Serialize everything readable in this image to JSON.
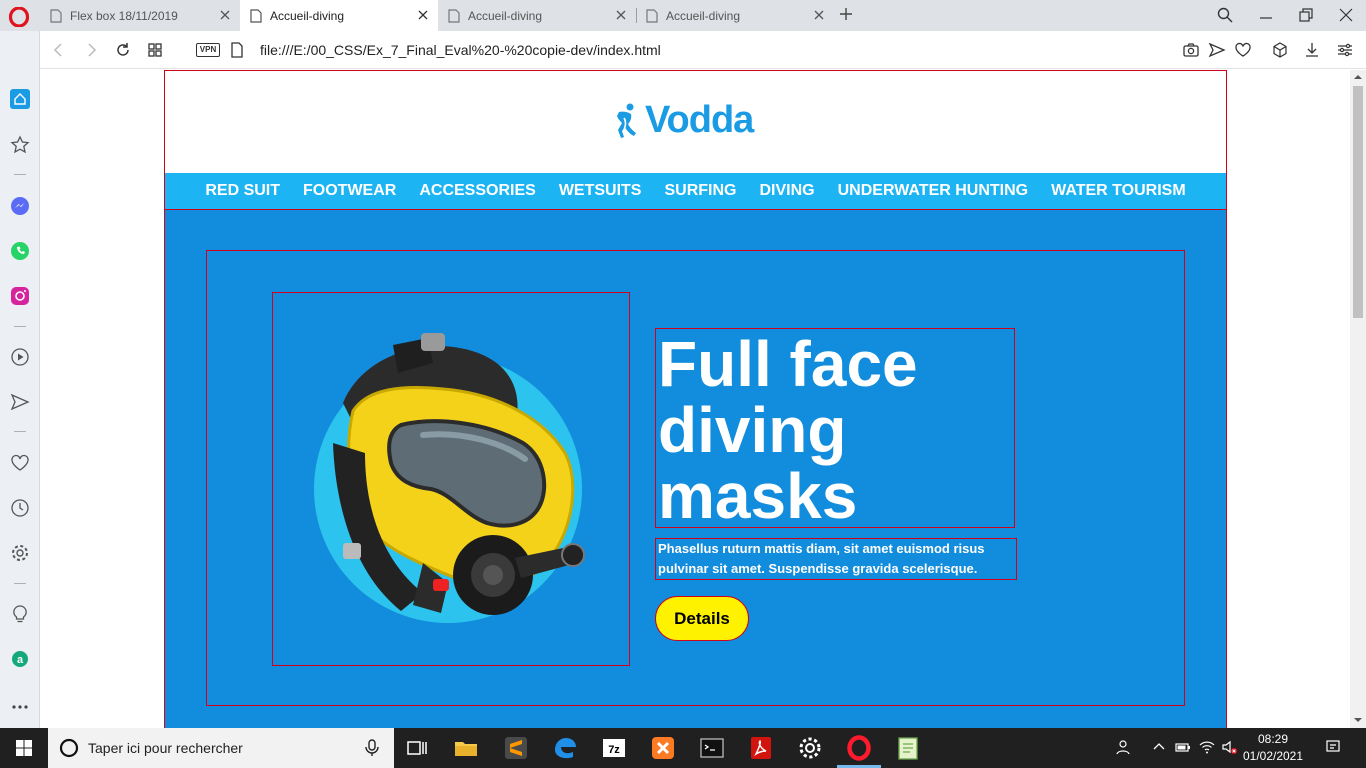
{
  "browser": {
    "tabs": [
      {
        "label": "Flex box 18/11/2019",
        "active": false
      },
      {
        "label": "Accueil-diving",
        "active": true
      },
      {
        "label": "Accueil-diving",
        "active": false
      },
      {
        "label": "Accueil-diving",
        "active": false
      }
    ],
    "vpn_label": "VPN",
    "url": "file:///E:/00_CSS/Ex_7_Final_Eval%20-%20copie-dev/index.html"
  },
  "site": {
    "logo_text": "Vodda",
    "nav": [
      "RED SUIT",
      "FOOTWEAR",
      "ACCESSORIES",
      "WETSUITS",
      "SURFING",
      "DIVING",
      "UNDERWATER HUNTING",
      "WATER TOURISM"
    ],
    "hero": {
      "title": "Full face diving masks",
      "description": "Phasellus ruturn mattis diam, sit amet euismod risus pulvinar sit amet. Suspendisse gravida scelerisque.",
      "button_label": "Details"
    }
  },
  "taskbar": {
    "search_placeholder": "Taper ici pour rechercher",
    "time": "08:29",
    "date": "01/02/2021"
  },
  "colors": {
    "brand_blue": "#1a9be4",
    "nav_blue": "#1db4f4",
    "hero_blue": "#128cdc",
    "button_yellow": "#fff200",
    "debug_border": "#d0021b"
  }
}
